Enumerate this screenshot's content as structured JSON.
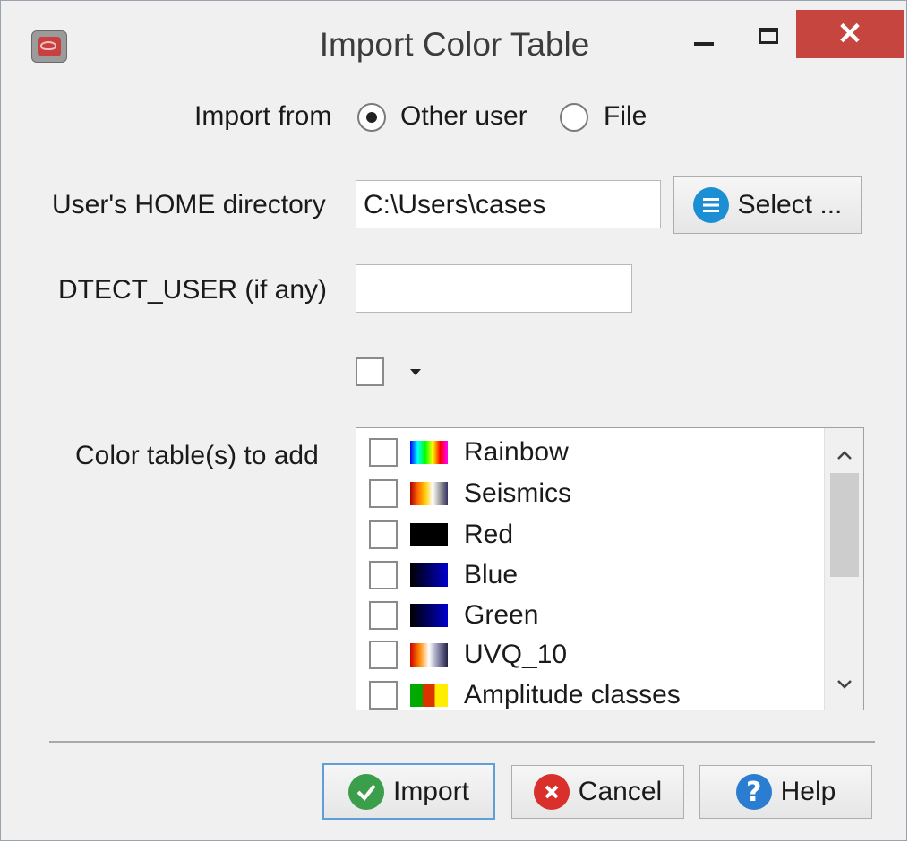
{
  "window": {
    "title": "Import Color Table",
    "close_glyph": "✕"
  },
  "import_from": {
    "label": "Import from",
    "options": [
      {
        "label": "Other user",
        "selected": true
      },
      {
        "label": "File",
        "selected": false
      }
    ]
  },
  "home_dir": {
    "label": "User's HOME directory",
    "value": "C:\\Users\\cases",
    "select_button": "Select ...",
    "select_icon": "list-icon"
  },
  "dtect_user": {
    "label": "DTECT_USER (if any)",
    "value": ""
  },
  "color_tables": {
    "label": "Color table(s) to add",
    "items": [
      {
        "name": "Rainbow",
        "checked": false,
        "swatch": "linear-gradient(90deg,#0000ff,#00ffff,#00ff00,#ffff00,#ff0000,#ff00ff)"
      },
      {
        "name": "Seismics",
        "checked": false,
        "swatch": "linear-gradient(90deg,#aa0000,#ff6600,#ffcc00,#ffffff,#999999,#333366)"
      },
      {
        "name": "Red",
        "checked": false,
        "swatch": "linear-gradient(90deg,#000000,#050000)"
      },
      {
        "name": "Blue",
        "checked": false,
        "swatch": "linear-gradient(90deg,#000000,#0000cc)"
      },
      {
        "name": "Green",
        "checked": false,
        "swatch": "linear-gradient(90deg,#000000,#0000cc)"
      },
      {
        "name": "UVQ_10",
        "checked": false,
        "swatch": "linear-gradient(90deg,#cc0000,#ff8800,#ffffff,#8888aa,#222244)"
      },
      {
        "name": "Amplitude classes",
        "checked": false,
        "swatch": "linear-gradient(90deg,#00aa00 0%,#00aa00 33%,#dd3300 33%,#dd3300 66%,#ffee00 66%)"
      }
    ]
  },
  "buttons": {
    "import": "Import",
    "cancel": "Cancel",
    "help": "Help"
  },
  "colors": {
    "close_red": "#c7453f",
    "import_green": "#3a9e4a",
    "cancel_red": "#d9302b",
    "help_blue": "#2a7dd1",
    "select_blue": "#1c8fd4"
  }
}
